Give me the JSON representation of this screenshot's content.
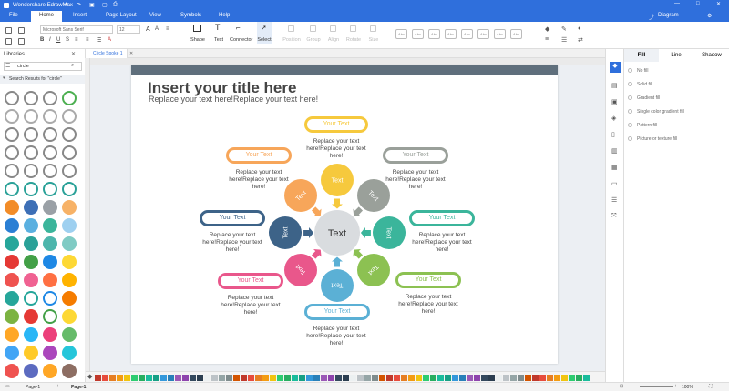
{
  "app": {
    "title": "Wondershare EdrawMax",
    "user": "Diagram"
  },
  "menu": {
    "file": "File",
    "home": "Home",
    "insert": "Insert",
    "page_layout": "Page Layout",
    "view": "View",
    "symbols": "Symbols",
    "help": "Help"
  },
  "ribbon": {
    "font_name": "Microsoft Sans Serif",
    "font_size": "12",
    "shape": "Shape",
    "text": "Text",
    "connector": "Connector",
    "select": "Select",
    "position": "Position",
    "group": "Group",
    "align": "Align",
    "rotate": "Rotate",
    "size": "Size"
  },
  "left": {
    "title": "Libraries",
    "search_value": "circle",
    "results_label": "Search Results for \"circle\""
  },
  "doc": {
    "tab_name": "Circle Spoke 1"
  },
  "diagram": {
    "title": "Insert your title here",
    "subtitle": "Replace your text here!Replace your text here!",
    "center": "Text",
    "spokes": [
      "Text",
      "Text",
      "Text",
      "Text",
      "Text",
      "Text",
      "Text",
      "Text"
    ],
    "boxes": [
      "Your Text",
      "Your Text",
      "Your Text",
      "Your Text",
      "Your Text",
      "Your Text",
      "Your Text",
      "Your Text"
    ],
    "desc": "Replace your text here!Replace your text here!"
  },
  "colors": {
    "yellow": "#f6c93d",
    "gray": "#9aa09a",
    "teal": "#3bb59b",
    "green": "#8cc152",
    "blue": "#5bb0d5",
    "pink": "#e9578b",
    "navy": "#3d6388",
    "orange": "#f7a65a"
  },
  "right": {
    "tabs": [
      "Fill",
      "Line",
      "Shadow"
    ],
    "options": [
      "No fill",
      "Solid fill",
      "Gradient fill",
      "Single color gradient fill",
      "Pattern fill",
      "Picture or texture fill"
    ]
  },
  "status": {
    "page_tab": "Page-1",
    "page_tab2": "Page-1",
    "zoom": "100%"
  }
}
